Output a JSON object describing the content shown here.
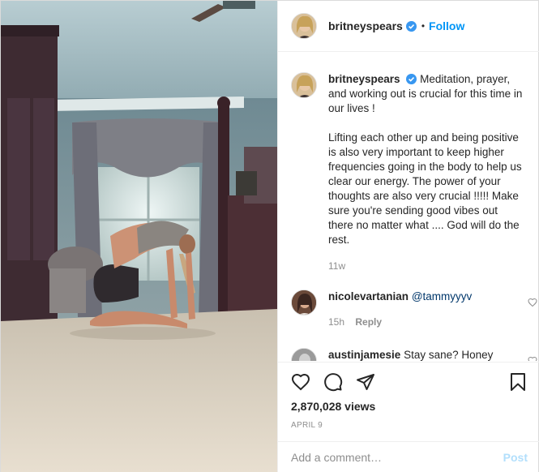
{
  "header": {
    "username": "britneyspears",
    "separator": "•",
    "follow_label": "Follow"
  },
  "caption": {
    "username": "britneyspears",
    "paragraphs": [
      "Meditation, prayer, and working out is crucial for this time in our lives !",
      "Lifting each other up and being positive is also very important to keep higher frequencies going in the body to help us clear our energy. The power of your thoughts are also very crucial !!!!! Make sure you're sending good vibes out there no matter what .... God will do the rest."
    ],
    "age": "11w"
  },
  "comments": [
    {
      "username": "nicolevartanian",
      "text": "@tammyyyv",
      "age": "15h",
      "reply_label": "Reply"
    },
    {
      "username": "austinjamesie",
      "text": "Stay sane? Honey",
      "age": "",
      "reply_label": ""
    }
  ],
  "stats": {
    "views": "2,870,028 views",
    "date": "APRIL 9"
  },
  "add_comment": {
    "placeholder": "Add a comment…",
    "post_label": "Post"
  },
  "colors": {
    "accent": "#0095f6",
    "muted": "#8e8e8e",
    "border": "#efefef",
    "verified": "#3897f0"
  },
  "icons": {
    "like": "heart-icon",
    "comment": "comment-icon",
    "share": "share-icon",
    "save": "bookmark-icon",
    "verified": "verified-badge-icon"
  }
}
